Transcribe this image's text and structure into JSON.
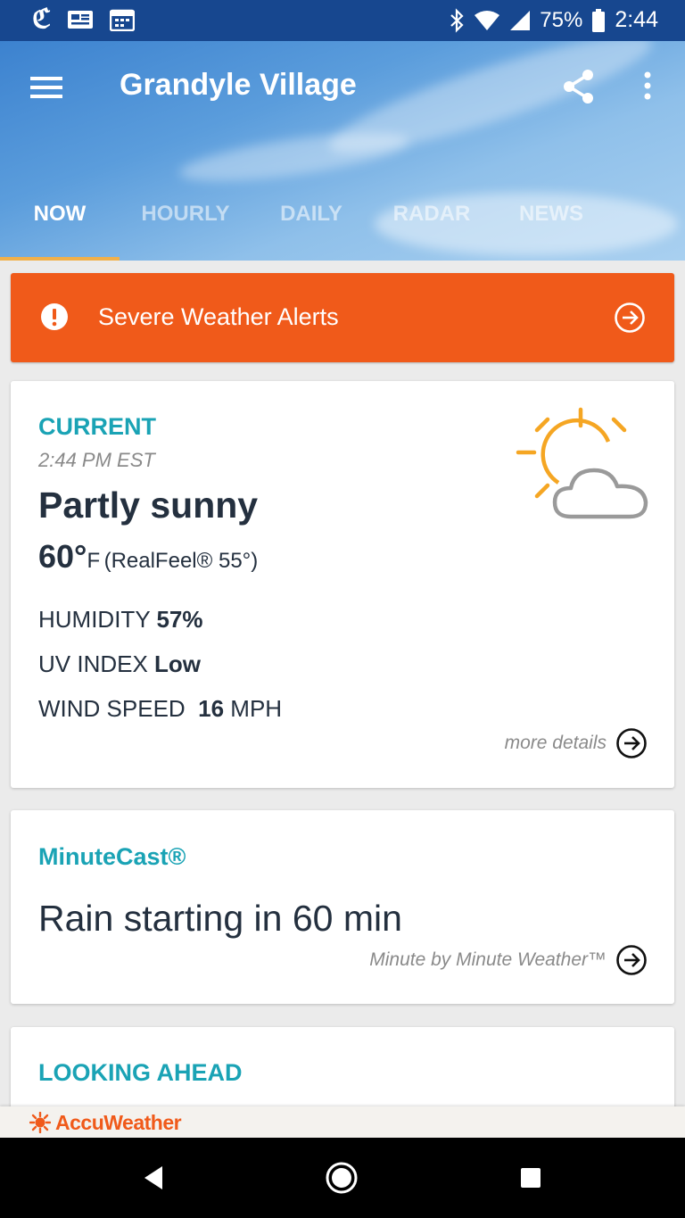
{
  "status_bar": {
    "left_icons": [
      "nyt-icon",
      "news-icon",
      "calendar-icon"
    ],
    "right_icons": [
      "bluetooth-icon",
      "wifi-icon",
      "signal-icon",
      "battery-icon"
    ],
    "battery": "75%",
    "time": "2:44"
  },
  "header": {
    "title": "Grandyle Village",
    "tabs": [
      {
        "label": "NOW",
        "active": true
      },
      {
        "label": "HOURLY",
        "active": false
      },
      {
        "label": "DAILY",
        "active": false
      },
      {
        "label": "RADAR",
        "active": false
      },
      {
        "label": "NEWS",
        "active": false
      }
    ]
  },
  "alert": {
    "label": "Severe Weather Alerts",
    "color": "#f05a1a"
  },
  "current": {
    "heading": "CURRENT",
    "time": "2:44 PM EST",
    "condition": "Partly sunny",
    "temp": "60°",
    "temp_unit": "F",
    "realfeel": "(RealFeel® 55°)",
    "humidity_label": "HUMIDITY",
    "humidity_value": "57%",
    "uv_label": "UV INDEX",
    "uv_value": "Low",
    "wind_label": "WIND SPEED",
    "wind_value": "16",
    "wind_unit": "MPH",
    "more_details": "more details",
    "icon": "partly-sunny-icon"
  },
  "minutecast": {
    "heading": "MinuteCast®",
    "text": "Rain starting in 60 min",
    "link": "Minute by Minute Weather™"
  },
  "looking_ahead": {
    "heading": "LOOKING AHEAD"
  },
  "brand": {
    "name": "AccuWeather"
  },
  "colors": {
    "accent_teal": "#1aa3b5",
    "status_bar": "#17478f",
    "tab_indicator": "#f1b04a",
    "sun": "#f5a623"
  }
}
